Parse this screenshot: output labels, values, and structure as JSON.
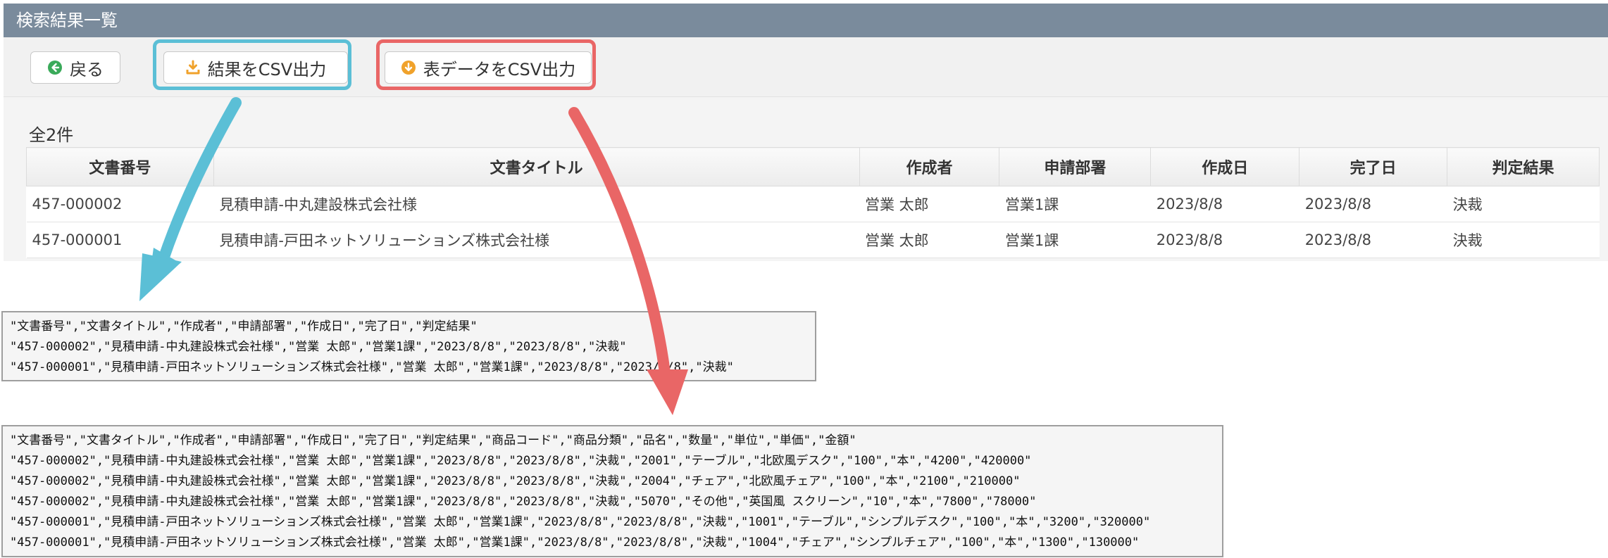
{
  "window": {
    "title": "検索結果一覧"
  },
  "toolbar": {
    "back_label": "戻る",
    "export_result_label": "結果をCSV出力",
    "export_table_label": "表データをCSV出力"
  },
  "results": {
    "count_text": "全2件",
    "columns": [
      "文書番号",
      "文書タイトル",
      "作成者",
      "申請部署",
      "作成日",
      "完了日",
      "判定結果"
    ],
    "rows": [
      [
        "457-000002",
        "見積申請-中丸建設株式会社様",
        "営業 太郎",
        "営業1課",
        "2023/8/8",
        "2023/8/8",
        "決裁"
      ],
      [
        "457-000001",
        "見積申請-戸田ネットソリューションズ株式会社様",
        "営業 太郎",
        "営業1課",
        "2023/8/8",
        "2023/8/8",
        "決裁"
      ]
    ]
  },
  "csv_result": {
    "lines": [
      "\"文書番号\",\"文書タイトル\",\"作成者\",\"申請部署\",\"作成日\",\"完了日\",\"判定結果\"",
      "\"457-000002\",\"見積申請-中丸建設株式会社様\",\"営業 太郎\",\"営業1課\",\"2023/8/8\",\"2023/8/8\",\"決裁\"",
      "\"457-000001\",\"見積申請-戸田ネットソリューションズ株式会社様\",\"営業 太郎\",\"営業1課\",\"2023/8/8\",\"2023/8/8\",\"決裁\""
    ]
  },
  "csv_table": {
    "lines": [
      "\"文書番号\",\"文書タイトル\",\"作成者\",\"申請部署\",\"作成日\",\"完了日\",\"判定結果\",\"商品コード\",\"商品分類\",\"品名\",\"数量\",\"単位\",\"単価\",\"金額\"",
      "\"457-000002\",\"見積申請-中丸建設株式会社様\",\"営業 太郎\",\"営業1課\",\"2023/8/8\",\"2023/8/8\",\"決裁\",\"2001\",\"テーブル\",\"北欧風デスク\",\"100\",\"本\",\"4200\",\"420000\"",
      "\"457-000002\",\"見積申請-中丸建設株式会社様\",\"営業 太郎\",\"営業1課\",\"2023/8/8\",\"2023/8/8\",\"決裁\",\"2004\",\"チェア\",\"北欧風チェア\",\"100\",\"本\",\"2100\",\"210000\"",
      "\"457-000002\",\"見積申請-中丸建設株式会社様\",\"営業 太郎\",\"営業1課\",\"2023/8/8\",\"2023/8/8\",\"決裁\",\"5070\",\"その他\",\"英国風 スクリーン\",\"10\",\"本\",\"7800\",\"78000\"",
      "\"457-000001\",\"見積申請-戸田ネットソリューションズ株式会社様\",\"営業 太郎\",\"営業1課\",\"2023/8/8\",\"2023/8/8\",\"決裁\",\"1001\",\"テーブル\",\"シンプルデスク\",\"100\",\"本\",\"3200\",\"320000\"",
      "\"457-000001\",\"見積申請-戸田ネットソリューションズ株式会社様\",\"営業 太郎\",\"営業1課\",\"2023/8/8\",\"2023/8/8\",\"決裁\",\"1004\",\"チェア\",\"シンプルチェア\",\"100\",\"本\",\"1300\",\"130000\""
    ]
  },
  "colors": {
    "titlebar": "#7a8b9c",
    "highlight_blue": "#5bbfd6",
    "highlight_red": "#e96666",
    "back_icon": "#3aaa5a",
    "export_icon": "#f0a22b"
  },
  "icons": {
    "back": "arrow-left-circle-icon",
    "export_result": "download-icon",
    "export_table": "arrow-down-circle-icon"
  }
}
